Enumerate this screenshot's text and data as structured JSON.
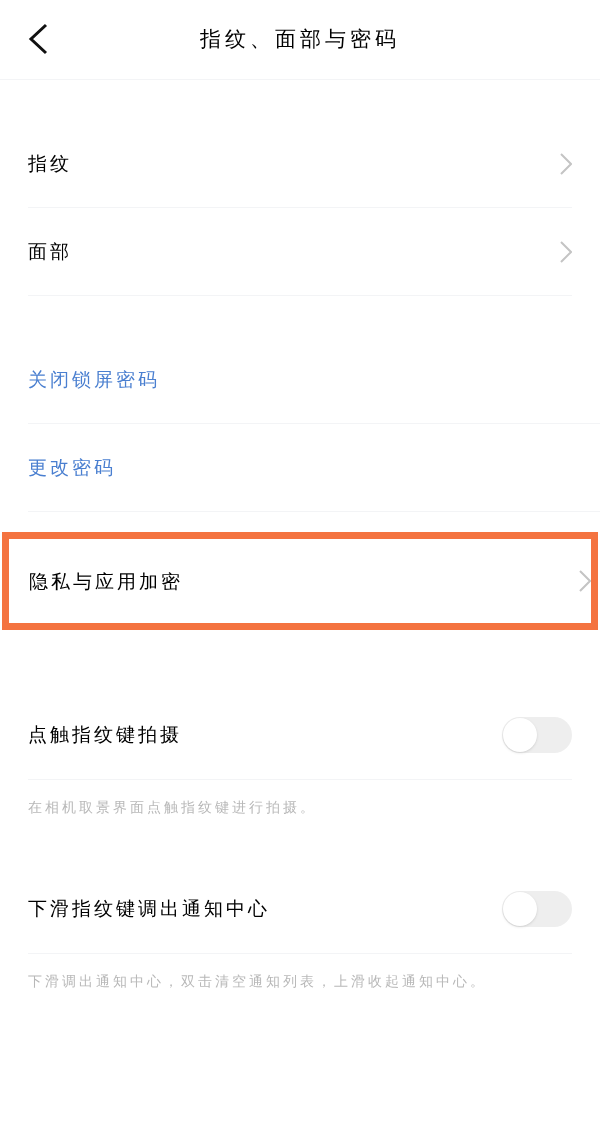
{
  "header": {
    "title": "指纹、面部与密码"
  },
  "items": [
    {
      "kind": "nav",
      "label": "指纹",
      "highlighted": false
    },
    {
      "kind": "nav",
      "label": "面部",
      "highlighted": false
    },
    {
      "kind": "gap"
    },
    {
      "kind": "action",
      "label": "关闭锁屏密码"
    },
    {
      "kind": "action",
      "label": "更改密码"
    },
    {
      "kind": "nav",
      "label": "隐私与应用加密",
      "highlighted": true
    },
    {
      "kind": "gap"
    },
    {
      "kind": "toggle",
      "label": "点触指纹键拍摄",
      "on": false,
      "hint": "在相机取景界面点触指纹键进行拍摄。"
    },
    {
      "kind": "gap"
    },
    {
      "kind": "toggle",
      "label": "下滑指纹键调出通知中心",
      "on": false,
      "hint": "下滑调出通知中心，双击清空通知列表，上滑收起通知中心。"
    }
  ]
}
